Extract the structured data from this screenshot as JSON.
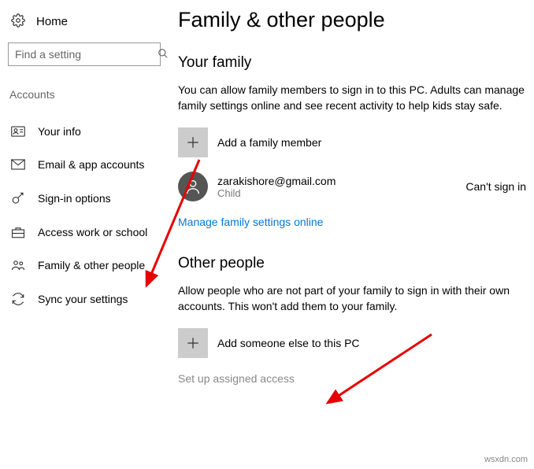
{
  "sidebar": {
    "home": "Home",
    "search_placeholder": "Find a setting",
    "category": "Accounts",
    "items": [
      {
        "label": "Your info"
      },
      {
        "label": "Email & app accounts"
      },
      {
        "label": "Sign-in options"
      },
      {
        "label": "Access work or school"
      },
      {
        "label": "Family & other people"
      },
      {
        "label": "Sync your settings"
      }
    ]
  },
  "main": {
    "title": "Family & other people",
    "section1": {
      "heading": "Your family",
      "desc": "You can allow family members to sign in to this PC. Adults can manage family settings online and see recent activity to help kids stay safe.",
      "add_label": "Add a family member",
      "user_email": "zarakishore@gmail.com",
      "user_role": "Child",
      "user_status": "Can't sign in",
      "manage_link": "Manage family settings online"
    },
    "section2": {
      "heading": "Other people",
      "desc": "Allow people who are not part of your family to sign in with their own accounts. This won't add them to your family.",
      "add_label": "Add someone else to this PC",
      "assigned": "Set up assigned access"
    }
  },
  "watermark": "wsxdn.com"
}
